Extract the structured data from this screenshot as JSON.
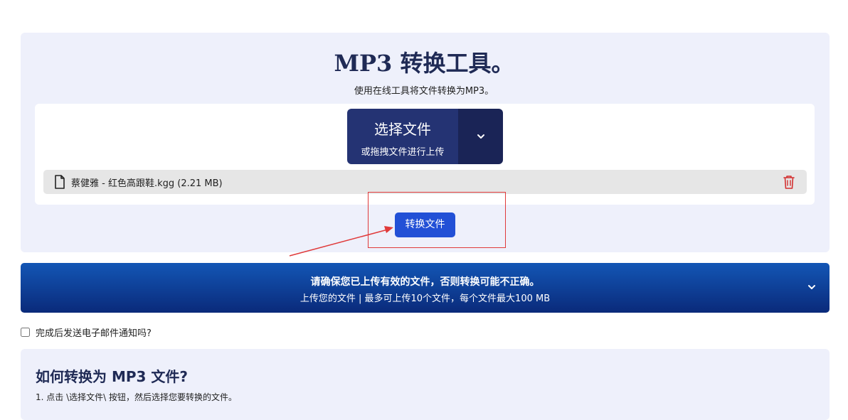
{
  "header": {
    "title": "MP3 转换工具。",
    "subtitle": "使用在线工具将文件转换为MP3。"
  },
  "upload": {
    "choose_label": "选择文件",
    "choose_sub": "或拖拽文件进行上传",
    "file_name": "蔡健雅 - 红色高跟鞋.kgg (2.21 MB)"
  },
  "convert": {
    "label": "转换文件"
  },
  "banner": {
    "main": "请确保您已上传有效的文件，否则转换可能不正确。",
    "sub": "上传您的文件 | 最多可上传10个文件，每个文件最大100 MB"
  },
  "email": {
    "label": "完成后发送电子邮件通知吗?",
    "checked": false
  },
  "howto": {
    "title": "如何转换为 MP3 文件?",
    "step1": "1. 点击 \\选择文件\\ 按钮，然后选择您要转换的文件。"
  },
  "colors": {
    "accent": "#2250d6",
    "choose_bg": "#243373",
    "annotation": "#e03a3a",
    "delete": "#d32f2f"
  }
}
